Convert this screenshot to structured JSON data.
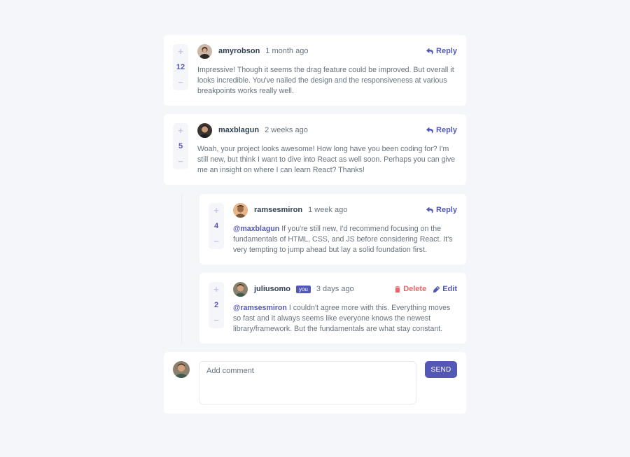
{
  "colors": {
    "accent": "#5357b6",
    "danger": "#ed6368",
    "background": "#f5f6fa",
    "card": "#ffffff"
  },
  "comments": [
    {
      "score": "12",
      "username": "amyrobson",
      "time": "1 month ago",
      "reply_label": "Reply",
      "text": "Impressive! Though it seems the drag feature could be improved. But overall it looks incredible. You've nailed the design and the responsiveness at various breakpoints works really well."
    },
    {
      "score": "5",
      "username": "maxblagun",
      "time": "2 weeks ago",
      "reply_label": "Reply",
      "text": "Woah, your project looks awesome! How long have you been coding for? I'm still new, but think I want to dive into React as well soon. Perhaps you can give me an insight on where I can learn React? Thanks!"
    }
  ],
  "replies": [
    {
      "score": "4",
      "username": "ramsesmiron",
      "time": "1 week ago",
      "reply_label": "Reply",
      "mention": "@maxblagun",
      "text": "If you're still new, I'd recommend focusing on the fundamentals of HTML, CSS, and JS before considering React. It's very tempting to jump ahead but lay a solid foundation first."
    },
    {
      "score": "2",
      "username": "juliusomo",
      "you_badge": "you",
      "time": "3 days ago",
      "delete_label": "Delete",
      "edit_label": "Edit",
      "mention": "@ramsesmiron",
      "text": "I couldn't agree more with this. Everything moves so fast and it always seems like everyone knows the newest library/framework. But the fundamentals are what stay constant."
    }
  ],
  "composer": {
    "placeholder": "Add comment",
    "send_label": "SEND"
  },
  "icons": {
    "upvote": "+",
    "downvote": "−",
    "reply": "reply-icon",
    "delete": "trash-icon",
    "edit": "pencil-icon"
  }
}
